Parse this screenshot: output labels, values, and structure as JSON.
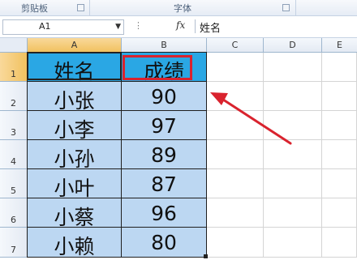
{
  "ribbon": {
    "groups": [
      {
        "label": "剪贴板"
      },
      {
        "label": "字体"
      }
    ]
  },
  "formula_bar": {
    "name_box": "A1",
    "fx_label": "fx",
    "formula_value": "姓名"
  },
  "grid": {
    "columns": [
      "A",
      "B",
      "C",
      "D",
      "E"
    ],
    "rows": [
      "1",
      "2",
      "3",
      "4",
      "5",
      "6",
      "7"
    ],
    "table": {
      "header": [
        "姓名",
        "成绩"
      ],
      "rows": [
        [
          "小张",
          "90"
        ],
        [
          "小李",
          "97"
        ],
        [
          "小孙",
          "89"
        ],
        [
          "小叶",
          "87"
        ],
        [
          "小蔡",
          "96"
        ],
        [
          "小赖",
          "80"
        ]
      ]
    }
  },
  "colors": {
    "header_fill": "#2aa7e4",
    "data_fill": "#bcd7f2",
    "annotation_red": "#d9232e"
  }
}
